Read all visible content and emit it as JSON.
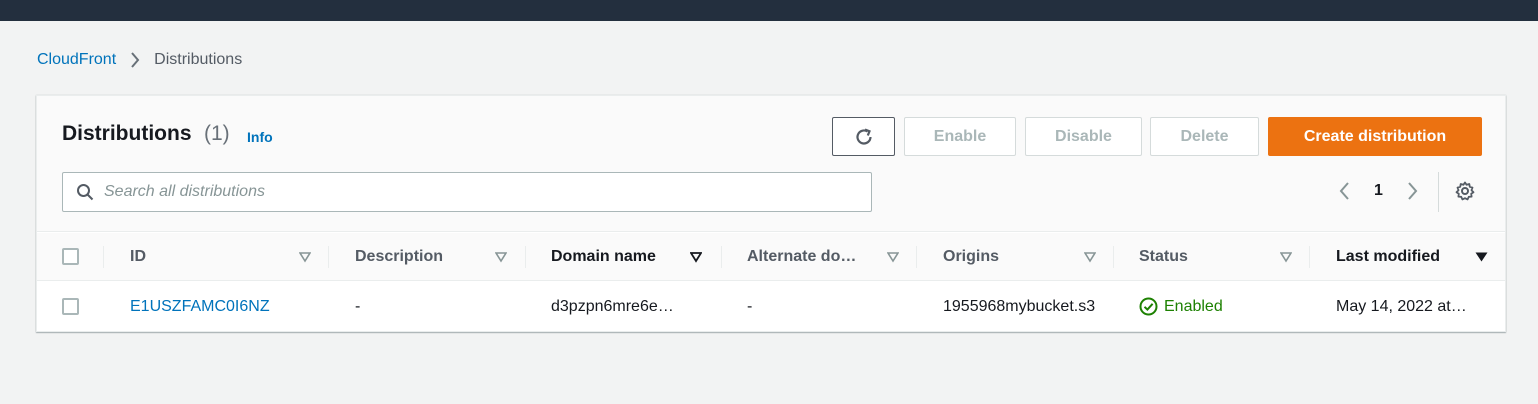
{
  "breadcrumb": {
    "root": "CloudFront",
    "current": "Distributions"
  },
  "header": {
    "title": "Distributions",
    "count": "(1)",
    "info": "Info"
  },
  "actions": {
    "refresh_icon": "refresh-icon",
    "enable": "Enable",
    "disable": "Disable",
    "delete": "Delete",
    "create": "Create distribution"
  },
  "search": {
    "placeholder": "Search all distributions",
    "value": ""
  },
  "pagination": {
    "current_page": "1"
  },
  "table": {
    "columns": [
      "ID",
      "Description",
      "Domain name",
      "Alternate do…",
      "Origins",
      "Status",
      "Last modified"
    ],
    "rows": [
      {
        "id": "E1USZFAMC0I6NZ",
        "description": "-",
        "domain": "d3pzpn6mre6e…",
        "alternate": "-",
        "origins": "1955968mybucket.s3",
        "status": "Enabled",
        "last_modified": "May 14, 2022 at…"
      }
    ]
  },
  "colors": {
    "accent": "#0073bb",
    "primary_button": "#ec7211",
    "topbar": "#232f3e",
    "status_success": "#1d8102"
  }
}
